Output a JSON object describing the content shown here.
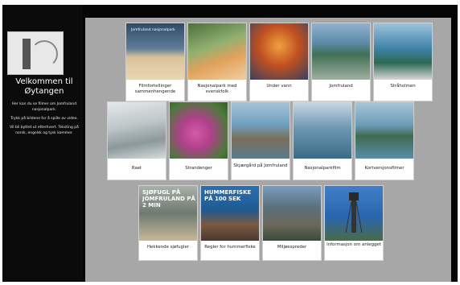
{
  "sidebar": {
    "title_line1": "Velkommen til",
    "title_line2": "Øytangen",
    "desc_1": "Her kan du se filmer om Jomfruland nasjonalpark.",
    "desc_2": "Trykk på bildene for å spille av video.",
    "desc_3": "Vil bli byttet ut etterhvert. Teksting på norsk, engelsk og tysk kommer."
  },
  "tiles": [
    {
      "caption": "Filmfortellinger sammenhengende",
      "tag": "Jomfruland nasjonalpark"
    },
    {
      "caption": "Nasjonalpark med svenskfolk"
    },
    {
      "caption": "Under vann"
    },
    {
      "caption": "Jomfruland"
    },
    {
      "caption": "Stråholmen"
    },
    {
      "caption": "Raet"
    },
    {
      "caption": "Strandenger"
    },
    {
      "caption": "Skjærgård på Jomfruland"
    },
    {
      "caption": "Nasjonalparkfilm"
    },
    {
      "caption": "Kortversjonsfilmer"
    },
    {
      "caption": "Hekkende sjøfugler",
      "overlay": "Sjøfugl på Jomfruland på 2 min"
    },
    {
      "caption": "Regler for hummerfiske",
      "overlay": "Hummerfiske på 100 sek"
    },
    {
      "caption": "Miljøespreder"
    },
    {
      "caption": "Informasjon om anlegget"
    }
  ]
}
